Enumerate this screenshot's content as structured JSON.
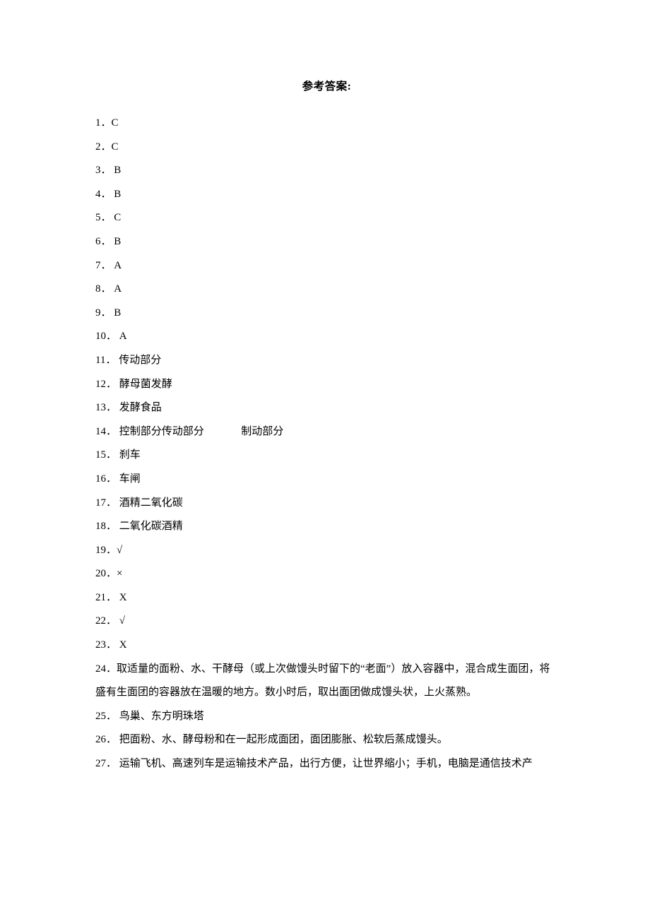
{
  "title": "参考答案:",
  "answers": [
    {
      "n": "1．",
      "v": "C"
    },
    {
      "n": "2．",
      "v": "C"
    },
    {
      "n": "3． ",
      "v": "B"
    },
    {
      "n": "4． ",
      "v": "B"
    },
    {
      "n": "5． ",
      "v": "C"
    },
    {
      "n": "6． ",
      "v": "B"
    },
    {
      "n": "7． ",
      "v": "A"
    },
    {
      "n": "8． ",
      "v": "A"
    },
    {
      "n": "9． ",
      "v": "B"
    },
    {
      "n": "10． ",
      "v": "A"
    },
    {
      "n": "11． ",
      "v": "传动部分"
    },
    {
      "n": "12． ",
      "v": "酵母菌发酵"
    },
    {
      "n": "13． ",
      "v": "发酵食品"
    },
    {
      "n": "14． ",
      "v": "控制部分传动部分              制动部分"
    },
    {
      "n": "15． ",
      "v": "刹车"
    },
    {
      "n": "16． ",
      "v": "车闸"
    },
    {
      "n": "17． ",
      "v": "酒精二氧化碳"
    },
    {
      "n": "18． ",
      "v": "二氧化碳酒精"
    },
    {
      "n": "19．",
      "v": "√"
    },
    {
      "n": "20．",
      "v": "×"
    },
    {
      "n": "21． ",
      "v": "X"
    },
    {
      "n": "22． ",
      "v": "√"
    },
    {
      "n": "23． ",
      "v": "X"
    },
    {
      "n": "24． ",
      "v": "取适量的面粉、水、干酵母（或上次做馒头时留下的“老面”）放入容器中，混合成生面团，将盛有生面团的容器放在温暖的地方。数小时后，取出面团做成馒头状，上火蒸熟。"
    },
    {
      "n": "25． ",
      "v": "鸟巢、东方明珠塔"
    },
    {
      "n": "26． ",
      "v": "把面粉、水、酵母粉和在一起形成面团，面团膨胀、松软后蒸成馒头。"
    },
    {
      "n": "27． ",
      "v": "运输飞机、高速列车是运输技术产品，出行方便，让世界缩小；手机，电脑是通信技术产"
    }
  ]
}
